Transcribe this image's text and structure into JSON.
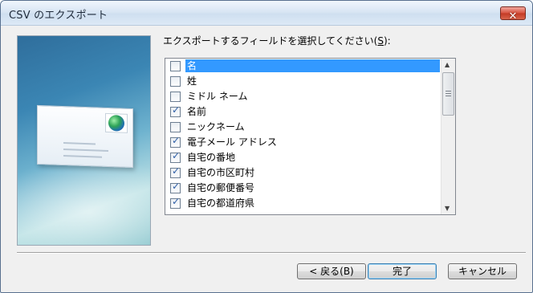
{
  "window": {
    "title": "CSV のエクスポート",
    "close_glyph": "✕"
  },
  "prompt": {
    "before": "エクスポートするフィールドを選択してください(",
    "accel": "S",
    "after": "):"
  },
  "fields": [
    {
      "label": "名",
      "checked": false,
      "selected": true
    },
    {
      "label": "姓",
      "checked": false,
      "selected": false
    },
    {
      "label": "ミドル ネーム",
      "checked": false,
      "selected": false
    },
    {
      "label": "名前",
      "checked": true,
      "selected": false
    },
    {
      "label": "ニックネーム",
      "checked": false,
      "selected": false
    },
    {
      "label": "電子メール アドレス",
      "checked": true,
      "selected": false
    },
    {
      "label": "自宅の番地",
      "checked": true,
      "selected": false
    },
    {
      "label": "自宅の市区町村",
      "checked": true,
      "selected": false
    },
    {
      "label": "自宅の郵便番号",
      "checked": true,
      "selected": false
    },
    {
      "label": "自宅の都道府県",
      "checked": true,
      "selected": false
    }
  ],
  "buttons": {
    "back": "< 戻る(B)",
    "finish": "完了",
    "cancel": "キャンセル"
  },
  "icons": {
    "check": "✓",
    "scroll_up": "▲",
    "scroll_down": "▼",
    "close": "close-icon"
  },
  "colors": {
    "selection": "#3399ff",
    "checkmark": "#3060a8"
  }
}
